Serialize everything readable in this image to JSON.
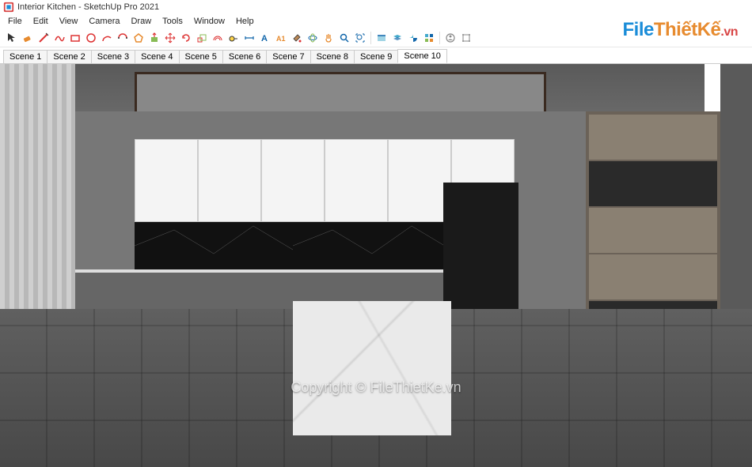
{
  "window": {
    "title": "Interior Kitchen - SketchUp Pro 2021"
  },
  "menu": {
    "items": [
      "File",
      "Edit",
      "View",
      "Camera",
      "Draw",
      "Tools",
      "Window",
      "Help"
    ]
  },
  "toolbar_icons": [
    "select",
    "eraser",
    "line",
    "freehand",
    "rectangle",
    "circle",
    "arc",
    "arc2",
    "polygon",
    "pushpull",
    "move",
    "rotate",
    "scale",
    "offset",
    "tape",
    "dimension",
    "text",
    "3dtext",
    "paint",
    "orbit",
    "pan",
    "zoom",
    "zoom-extents",
    "section",
    "layers",
    "shadows",
    "styles",
    "outliner",
    "components",
    "person",
    "tag"
  ],
  "scenes": {
    "tabs": [
      "Scene 1",
      "Scene 2",
      "Scene 3",
      "Scene 4",
      "Scene 5",
      "Scene 6",
      "Scene 7",
      "Scene 8",
      "Scene 9",
      "Scene 10"
    ],
    "active": "Scene 10"
  },
  "watermark": {
    "logo_part1": "File",
    "logo_part2": "ThiếtKế",
    "logo_part3": ".vn",
    "center_text": "Copyright © FileThietKe.vn"
  },
  "colors": {
    "accent": "#1a8cd8",
    "orange": "#e78b2f",
    "red": "#d84545"
  }
}
